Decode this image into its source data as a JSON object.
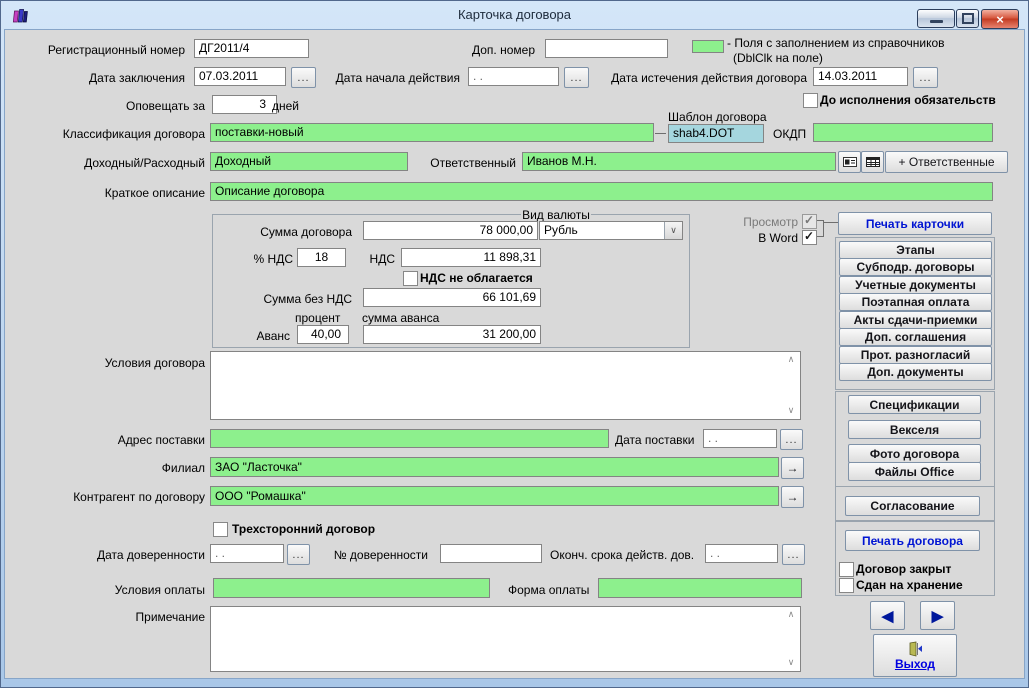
{
  "window": {
    "title": "Карточка договора"
  },
  "ui": {
    "ellipsis": "...",
    "arrow_right": "→",
    "nav_prev": "◀",
    "nav_next": "▶",
    "scroll_up": "∧",
    "scroll_down": "∨",
    "combo_arrow": "∨",
    "close_glyph": "×"
  },
  "legend": {
    "swatch_color": "#8df08d",
    "line1": "-  Поля с заполнением из справочников",
    "line2": "(DblClk на поле)"
  },
  "fields": {
    "reg_number": {
      "label": "Регистрационный номер",
      "value": "ДГ2011/4"
    },
    "extra_number": {
      "label": "Доп. номер",
      "value": ""
    },
    "conclusion_date": {
      "label": "Дата заключения",
      "value": "07.03.2011"
    },
    "start_date": {
      "label": "Дата начала действия",
      "value": " .  ."
    },
    "expiry_date": {
      "label": "Дата истечения действия договора",
      "value": "14.03.2011"
    },
    "until_fulfilled_label": "До исполнения обязательств",
    "notify": {
      "label": "Оповещать за",
      "value": "3",
      "unit": "дней"
    },
    "classification": {
      "label": "Классификация договора",
      "value": "поставки-новый"
    },
    "template": {
      "label": "Шаблон договора",
      "value": "shab4.DOT"
    },
    "okdp": {
      "label": "ОКДП",
      "value": ""
    },
    "profit_type": {
      "label": "Доходный/Расходный",
      "value": "Доходный"
    },
    "responsible": {
      "label": "Ответственный",
      "value": "Иванов М.Н.",
      "add_button": "+ Ответственные"
    },
    "short_description": {
      "label": "Краткое описание",
      "value": "Описание договора"
    }
  },
  "sum_box": {
    "group_label": "Вид валюты",
    "contract_sum": {
      "label": "Сумма договора",
      "value": "78 000,00"
    },
    "currency": {
      "value": "Рубль"
    },
    "vat_percent": {
      "label": "% НДС",
      "value": "18"
    },
    "vat": {
      "label": "НДС",
      "value": "11 898,31"
    },
    "vat_exempt_label": "НДС не облагается",
    "sum_no_vat": {
      "label": "Сумма без НДС",
      "value": "66 101,69"
    },
    "advance": {
      "label": "Аванс",
      "percent_label": "процент",
      "amount_label": "сумма аванса",
      "percent": "40,00",
      "amount": "31 200,00"
    }
  },
  "details": {
    "terms": {
      "label": "Условия договора",
      "value": ""
    },
    "delivery_address": {
      "label": "Адрес поставки",
      "value": ""
    },
    "delivery_date": {
      "label": "Дата поставки",
      "value": " .  ."
    },
    "branch": {
      "label": "Филиал",
      "value": "ЗАО \"Ласточка\""
    },
    "counterparty": {
      "label": "Контрагент по договору",
      "value": "ООО \"Ромашка\""
    },
    "tripartite_label": "Трехсторонний договор",
    "poa_date": {
      "label": "Дата доверенности",
      "value": " .  ."
    },
    "poa_number": {
      "label": "№ доверенности",
      "value": ""
    },
    "poa_expiry": {
      "label": "Оконч. срока действ. дов.",
      "value": " .  ."
    },
    "payment_terms": {
      "label": "Условия оплаты",
      "value": ""
    },
    "payment_form": {
      "label": "Форма оплаты",
      "value": ""
    },
    "note": {
      "label": "Примечание",
      "value": ""
    }
  },
  "right_panel": {
    "preview_label": "Просмотр",
    "word_label": "В Word",
    "print_card": "Печать карточки",
    "buttons": [
      "Этапы",
      "Субподр. договоры",
      "Учетные документы",
      "Поэтапная оплата",
      "Акты сдачи-приемки",
      "Доп. соглашения",
      "Прот. разногласий",
      "Доп. документы"
    ],
    "doc_buttons": [
      "Спецификации",
      "Векселя",
      "Фото договора",
      "Файлы Office"
    ],
    "approval": "Согласование",
    "print_contract": "Печать договора",
    "closed_label": "Договор закрыт",
    "stored_label": "Сдан на хранение",
    "exit_label": "Выход"
  }
}
